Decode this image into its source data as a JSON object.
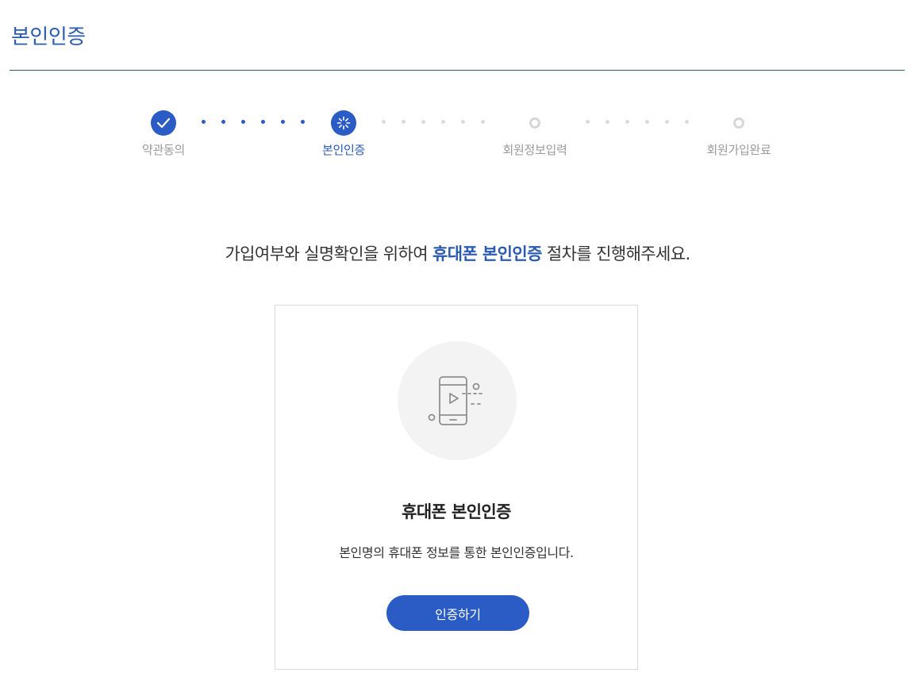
{
  "page": {
    "title": "본인인증"
  },
  "steps": [
    {
      "label": "약관동의",
      "state": "done"
    },
    {
      "label": "본인인증",
      "state": "current"
    },
    {
      "label": "회원정보입력",
      "state": "pending"
    },
    {
      "label": "회원가입완료",
      "state": "pending"
    }
  ],
  "lead": {
    "before": "가입여부와 실명확인을 위하여 ",
    "highlight": "휴대폰 본인인증",
    "after": " 절차를 진행해주세요."
  },
  "card": {
    "icon": "mobile-video-icon",
    "title": "휴대폰 본인인증",
    "description": "본인명의 휴대폰 정보를 통한 본인인증입니다.",
    "button_label": "인증하기"
  },
  "colors": {
    "accent": "#2b5bc4",
    "title_text": "#2b5bb0",
    "rule": "#2f5a63",
    "inactive": "#d6d6d6"
  }
}
